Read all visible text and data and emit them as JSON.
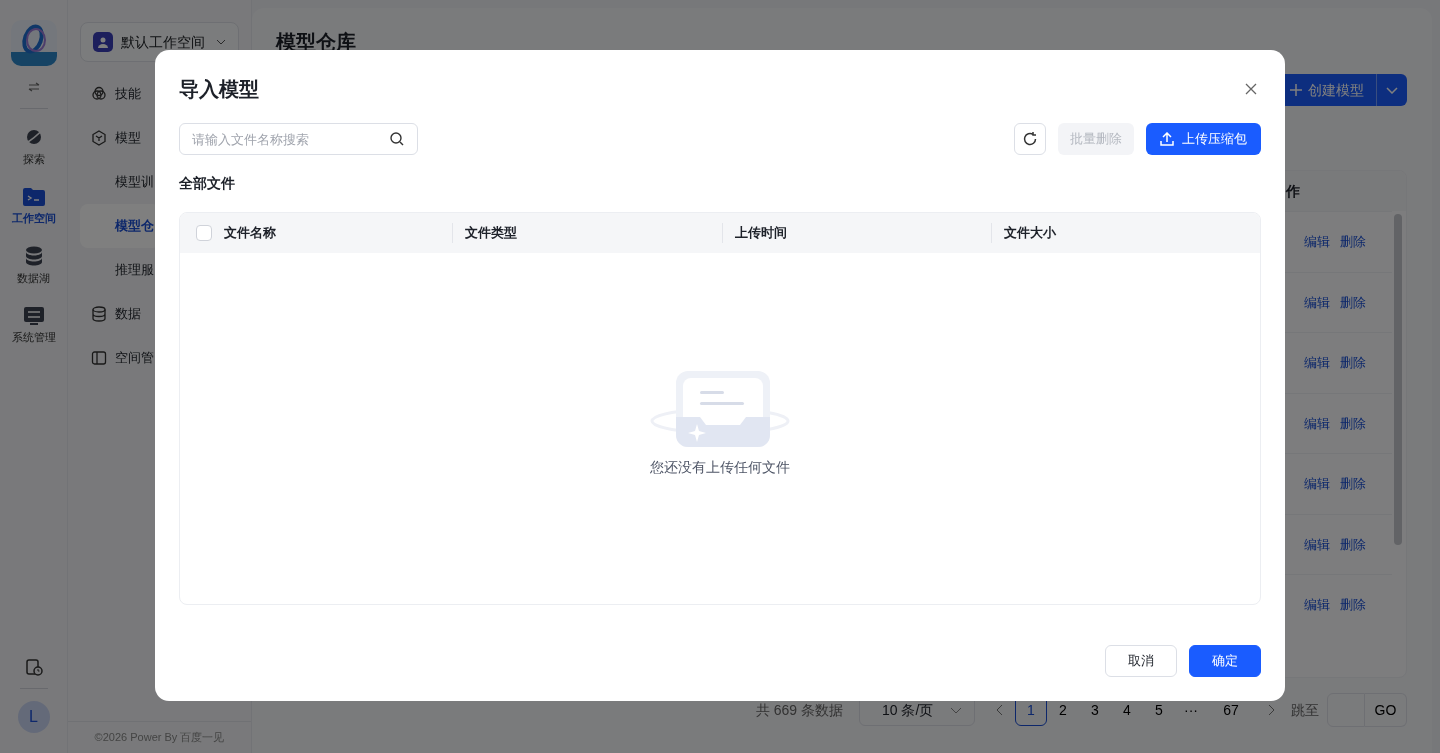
{
  "rail": {
    "items": [
      {
        "label": "探索",
        "selected": false
      },
      {
        "label": "工作空间",
        "selected": true
      },
      {
        "label": "数据湖",
        "selected": false
      },
      {
        "label": "系统管理",
        "selected": false
      }
    ],
    "avatar": "L"
  },
  "sidebar": {
    "workspace": "默认工作空间",
    "items": [
      {
        "label": "技能",
        "selected": false
      },
      {
        "label": "模型",
        "selected": false,
        "children": [
          {
            "label": "模型训",
            "selected": false
          },
          {
            "label": "模型仓",
            "selected": true
          },
          {
            "label": "推理服",
            "selected": false
          }
        ]
      },
      {
        "label": "数据",
        "selected": false
      },
      {
        "label": "空间管",
        "selected": false
      }
    ],
    "footer": "©2026 Power By 百度一见"
  },
  "page": {
    "title": "模型仓库",
    "create_button": "创建模型",
    "table": {
      "column_header": "作",
      "rows": [
        {
          "actions": [
            "编辑",
            "删除"
          ]
        },
        {
          "actions": [
            "编辑",
            "删除"
          ]
        },
        {
          "actions": [
            "编辑",
            "删除"
          ]
        },
        {
          "actions": [
            "编辑",
            "删除"
          ]
        },
        {
          "actions": [
            "编辑",
            "删除"
          ]
        },
        {
          "actions": [
            "编辑",
            "删除"
          ]
        },
        {
          "actions": [
            "编辑",
            "删除"
          ]
        }
      ]
    },
    "pagination": {
      "total": "共 669 条数据",
      "page_size": "10 条/页",
      "pages": [
        {
          "label": "1",
          "selected": true
        },
        {
          "label": "2",
          "selected": false
        },
        {
          "label": "3",
          "selected": false
        },
        {
          "label": "4",
          "selected": false
        },
        {
          "label": "5",
          "selected": false
        },
        {
          "label": "···",
          "selected": false
        },
        {
          "label": "67",
          "selected": false
        }
      ],
      "jump_label": "跳至",
      "go": "GO"
    }
  },
  "modal": {
    "title": "导入模型",
    "search": {
      "placeholder": "请输入文件名称搜索"
    },
    "batch_delete": {
      "label": "批量删除",
      "disabled": true
    },
    "upload": "上传压缩包",
    "section_title": "全部文件",
    "table": {
      "columns": [
        "文件名称",
        "文件类型",
        "上传时间",
        "文件大小"
      ],
      "select_all_checked": false,
      "empty_text": "您还没有上传任何文件"
    },
    "buttons": [
      {
        "label": "取消",
        "kind": "secondary"
      },
      {
        "label": "确定",
        "kind": "primary"
      }
    ]
  }
}
